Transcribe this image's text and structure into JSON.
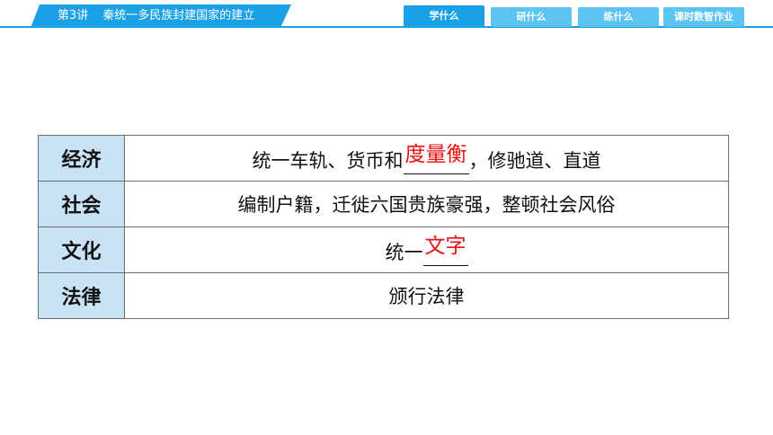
{
  "header": {
    "lesson": "第3讲",
    "title": "秦统一多民族封建国家的建立",
    "accent_color": "#1aa0e6",
    "nav": [
      {
        "label": "学什么",
        "active": true
      },
      {
        "label": "研什么",
        "active": false
      },
      {
        "label": "练什么",
        "active": false
      },
      {
        "label": "课时数智作业",
        "active": false
      }
    ]
  },
  "table": {
    "rows": [
      {
        "head": "经济",
        "before": "统一车轨、货币和",
        "answer": "度量衡",
        "after": "，修驰道、直道"
      },
      {
        "head": "社会",
        "text": "编制户籍，迁徙六国贵族豪强，整顿社会风俗"
      },
      {
        "head": "文化",
        "before": "统一",
        "answer": "文字",
        "after": ""
      },
      {
        "head": "法律",
        "text": "颁行法律"
      }
    ],
    "answer_color": "#e8130f"
  }
}
